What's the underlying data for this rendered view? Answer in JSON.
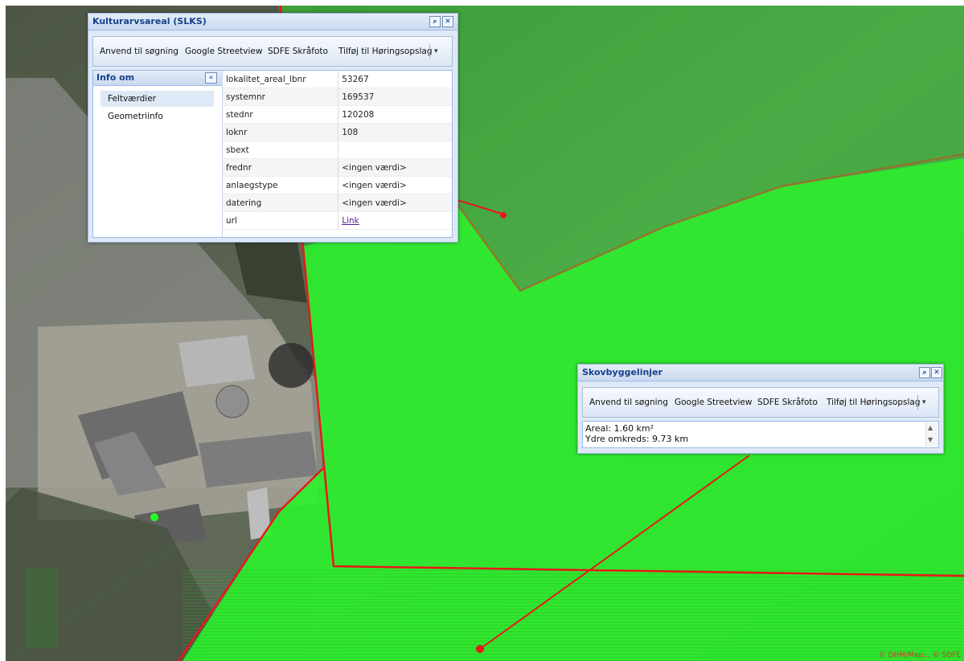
{
  "map": {
    "attribution": "© DHM/Map... © SDFE"
  },
  "colors": {
    "green_zone": "#2cf02c",
    "boundary_red": "#e81818",
    "window_title": "#15428b",
    "window_border": "#99bbe8"
  },
  "windows": {
    "kultur": {
      "title": "Kulturarvsareal (SLKS)",
      "zoom_icon": "magnifier-icon",
      "close_icon": "close-icon",
      "toolbar": {
        "btn1": "Anvend til søgning",
        "btn2": "Google Streetview",
        "btn3": "SDFE Skråfoto",
        "btn4": "Tilføj til Høringsopslag",
        "more": "▾"
      },
      "sidebar": {
        "title": "Info om",
        "collapse": "«",
        "items": [
          "Feltværdier",
          "Geometriinfo"
        ]
      },
      "fields": [
        {
          "key": "lokalitet_areal_lbnr",
          "value": "53267"
        },
        {
          "key": "systemnr",
          "value": "169537"
        },
        {
          "key": "stednr",
          "value": "120208"
        },
        {
          "key": "loknr",
          "value": "108"
        },
        {
          "key": "sbext",
          "value": ""
        },
        {
          "key": "frednr",
          "value": "<ingen værdi>"
        },
        {
          "key": "anlaegstype",
          "value": "<ingen værdi>"
        },
        {
          "key": "datering",
          "value": "<ingen værdi>"
        },
        {
          "key": "url",
          "value": "Link"
        }
      ]
    },
    "skov": {
      "title": "Skovbyggelinjer",
      "toolbar": {
        "btn1": "Anvend til søgning",
        "btn2": "Google Streetview",
        "btn3": "SDFE Skråfoto",
        "btn4": "Tilføj til Høringsopslag",
        "more": "▾"
      },
      "info": {
        "areal": "Areal: 1.60 km²",
        "omkreds": "Ydre omkreds: 9.73 km"
      }
    }
  }
}
